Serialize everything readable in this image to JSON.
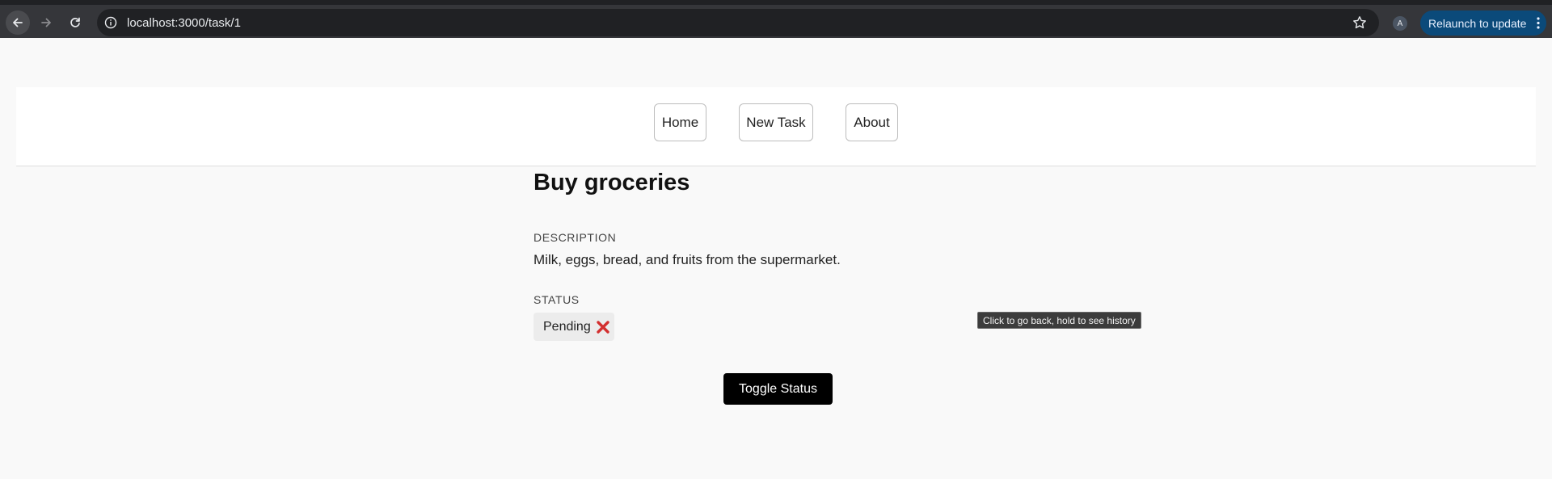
{
  "browser": {
    "url": "localhost:3000/task/1",
    "profile_initial": "A",
    "relaunch_label": "Relaunch to update"
  },
  "nav": {
    "items": [
      {
        "label": "Home"
      },
      {
        "label": "New Task"
      },
      {
        "label": "About"
      }
    ]
  },
  "task": {
    "title": "Buy groceries",
    "description_label": "DESCRIPTION",
    "description": "Milk, eggs, bread, and fruits from the supermarket.",
    "status_label": "STATUS",
    "status": "Pending",
    "status_icon": "cross-mark-icon",
    "toggle_label": "Toggle Status"
  },
  "tooltip": {
    "text": "Click to go back, hold to see history"
  },
  "colors": {
    "toolbar": "#35363a",
    "omnibox": "#202124",
    "relaunch": "#0b4a7a",
    "status_cross": "#d32f2f",
    "toggle_button": "#000000"
  }
}
